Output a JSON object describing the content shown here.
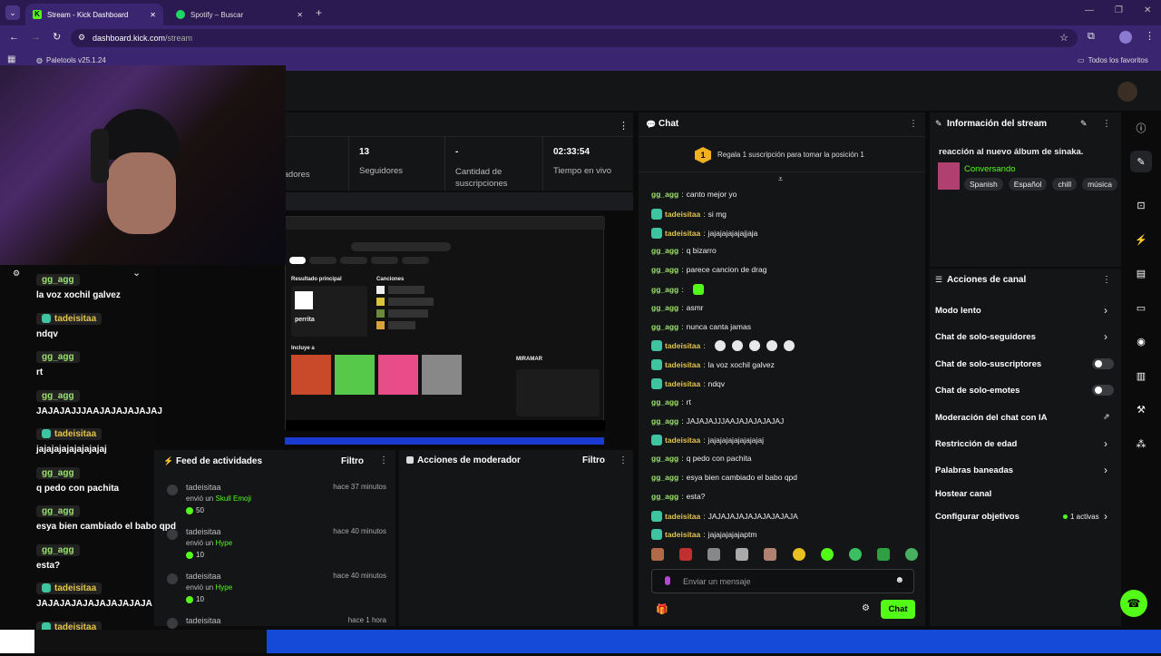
{
  "browser": {
    "tabs": [
      {
        "label": "Stream - Kick Dashboard"
      },
      {
        "label": "Spotify – Buscar"
      }
    ],
    "url_host": "dashboard.kick.com",
    "url_path": "/stream",
    "bookmark": "Paletools v25.1.24",
    "all_favorites": "Todos los favoritos"
  },
  "stats": [
    {
      "value": "",
      "label": "tadores"
    },
    {
      "value": "13",
      "label": "Seguidores"
    },
    {
      "value": "-",
      "label": "Cantidad de suscripciones"
    },
    {
      "value": "02:33:54",
      "label": "Tiempo en vivo"
    }
  ],
  "chat": {
    "title": "Chat",
    "pinned": "Regala 1 suscripción para tomar la posición 1",
    "pinned_rank": "1",
    "messages": [
      {
        "user": "gg_agg",
        "text": "canto mejor yo",
        "type": "g"
      },
      {
        "user": "tadeisitaa",
        "text": "si mg",
        "type": "t"
      },
      {
        "user": "tadeisitaa",
        "text": "jajajajajajajjaja",
        "type": "t"
      },
      {
        "user": "gg_agg",
        "text": "q bizarro",
        "type": "g"
      },
      {
        "user": "gg_agg",
        "text": "parece cancion de drag",
        "type": "g"
      },
      {
        "user": "gg_agg",
        "text": "",
        "type": "g"
      },
      {
        "user": "gg_agg",
        "text": "asmr",
        "type": "g"
      },
      {
        "user": "gg_agg",
        "text": "nunca canta jamas",
        "type": "g"
      },
      {
        "user": "tadeisitaa",
        "text": "",
        "type": "t"
      },
      {
        "user": "tadeisitaa",
        "text": "la voz xochil galvez",
        "type": "t"
      },
      {
        "user": "tadeisitaa",
        "text": "ndqv",
        "type": "t"
      },
      {
        "user": "gg_agg",
        "text": "rt",
        "type": "g"
      },
      {
        "user": "gg_agg",
        "text": "JAJAJAJJJAAJAJAJAJAJAJ",
        "type": "g"
      },
      {
        "user": "tadeisitaa",
        "text": "jajajajajajajajajaj",
        "type": "t"
      },
      {
        "user": "gg_agg",
        "text": "q pedo con pachita",
        "type": "g"
      },
      {
        "user": "gg_agg",
        "text": "esya bien cambiado el babo qpd",
        "type": "g"
      },
      {
        "user": "gg_agg",
        "text": "esta?",
        "type": "g"
      },
      {
        "user": "tadeisitaa",
        "text": "JAJAJAJAJAJAJAJAJAJA",
        "type": "t"
      },
      {
        "user": "tadeisitaa",
        "text": "jajajajajajaptm",
        "type": "t"
      }
    ],
    "input_placeholder": "Enviar un mensaje",
    "send_label": "Chat"
  },
  "stream_info": {
    "title": "Información del stream",
    "description": "reacción al nuevo álbum de sinaka.",
    "category": "Conversando",
    "tags": [
      "Spanish",
      "Español",
      "chill",
      "música"
    ]
  },
  "channel_actions": {
    "title": "Acciones de canal",
    "items": [
      {
        "label": "Modo lento"
      },
      {
        "label": "Chat de solo-seguidores"
      },
      {
        "label": "Chat de solo-suscriptores"
      },
      {
        "label": "Chat de solo-emotes"
      },
      {
        "label": "Moderación del chat con IA"
      },
      {
        "label": "Restricción de edad"
      },
      {
        "label": "Palabras baneadas"
      },
      {
        "label": "Hostear canal"
      },
      {
        "label": "Configurar objetivos"
      }
    ],
    "goals_status": "1 activas"
  },
  "activity": {
    "title": "Feed de actividades",
    "filter": "Filtro",
    "items": [
      {
        "user": "tadeisitaa",
        "action": "envió un",
        "item": "Skull Emoji",
        "amount": "50",
        "time": "hace 37 minutos"
      },
      {
        "user": "tadeisitaa",
        "action": "envió un",
        "item": "Hype",
        "amount": "10",
        "time": "hace 40 minutos"
      },
      {
        "user": "tadeisitaa",
        "action": "envió un",
        "item": "Hype",
        "amount": "10",
        "time": "hace 40 minutos"
      },
      {
        "user": "tadeisitaa",
        "action": "",
        "item": "",
        "amount": "",
        "time": "hace 1 hora"
      }
    ]
  },
  "moderator": {
    "title": "Acciones de moderador",
    "filter": "Filtro"
  },
  "overlay_chat": [
    {
      "user": "gg_agg",
      "text": "la voz xochil galvez"
    },
    {
      "user": "tadeisitaa",
      "text": "ndqv"
    },
    {
      "user": "gg_agg",
      "text": "rt"
    },
    {
      "user": "gg_agg",
      "text": "JAJAJAJJJAAJAJAJAJAJAJ"
    },
    {
      "user": "tadeisitaa",
      "text": "jajajajajajajajajaj"
    },
    {
      "user": "gg_agg",
      "text": "q pedo con pachita"
    },
    {
      "user": "gg_agg",
      "text": "esya bien cambiado el babo qpd"
    },
    {
      "user": "gg_agg",
      "text": "esta?"
    },
    {
      "user": "tadeisitaa",
      "text": "JAJAJAJAJAJAJAJAJAJA"
    },
    {
      "user": "tadeisitaa",
      "text": "jajajajajajaptm"
    }
  ],
  "preview": {
    "result_title": "Resultado principal",
    "result_name": "perrita",
    "songs_title": "Canciones",
    "includes": "Incluye a",
    "artist": "MIRAMAR"
  },
  "colors": {
    "kick_green": "#53fc18",
    "panel": "#141517",
    "browser_purple": "#3a2670"
  }
}
